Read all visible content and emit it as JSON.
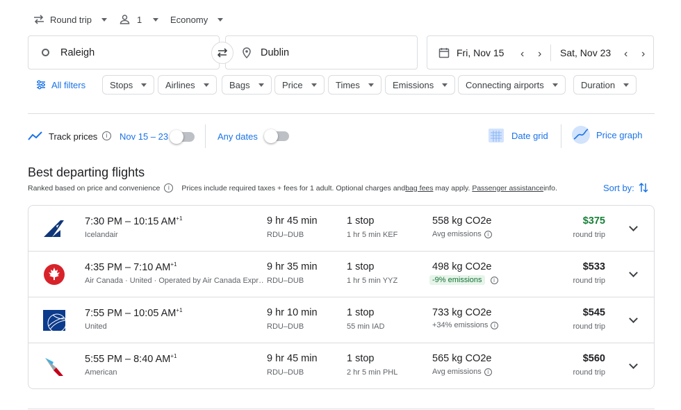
{
  "top": {
    "trip_type": "Round trip",
    "passengers": "1",
    "cabin": "Economy"
  },
  "search": {
    "origin": "Raleigh",
    "destination": "Dublin",
    "depart_date": "Fri, Nov 15",
    "return_date": "Sat, Nov 23"
  },
  "filters": {
    "all_label": "All filters",
    "chips": [
      "Stops",
      "Airlines",
      "Bags",
      "Price",
      "Times",
      "Emissions",
      "Connecting airports",
      "Duration"
    ]
  },
  "tracking": {
    "track_label": "Track prices",
    "date_range": "Nov 15 – 23",
    "any_dates": "Any dates",
    "date_grid": "Date grid",
    "price_graph": "Price graph"
  },
  "section": {
    "title": "Best departing flights",
    "ranked": "Ranked based on price and convenience",
    "info_prefix": "Prices include required taxes + fees for 1 adult. Optional charges and ",
    "bag_fees": "bag fees",
    "info_middle": " may apply. ",
    "passenger_assistance": "Passenger assistance",
    "info_suffix": " info.",
    "sort_label": "Sort by:"
  },
  "flights": [
    {
      "times": "7:30 PM – 10:15 AM",
      "plus_day": "+1",
      "airline": "Icelandair",
      "duration": "9 hr 45 min",
      "route": "RDU–DUB",
      "stops": "1 stop",
      "layover": "1 hr 5 min KEF",
      "co2": "558 kg CO2e",
      "emissions_note": "Avg emissions",
      "price": "$375",
      "price_type": "round trip",
      "price_color": "#188038"
    },
    {
      "times": "4:35 PM – 7:10 AM",
      "plus_day": "+1",
      "airline": "Air Canada · United · Operated by Air Canada Expr…",
      "duration": "9 hr 35 min",
      "route": "RDU–DUB",
      "stops": "1 stop",
      "layover": "1 hr 5 min YYZ",
      "co2": "498 kg CO2e",
      "emissions_note": "-9% emissions",
      "price": "$533",
      "price_type": "round trip",
      "price_color": "#202124"
    },
    {
      "times": "7:55 PM – 10:05 AM",
      "plus_day": "+1",
      "airline": "United",
      "duration": "9 hr 10 min",
      "route": "RDU–DUB",
      "stops": "1 stop",
      "layover": "55 min IAD",
      "co2": "733 kg CO2e",
      "emissions_note": "+34% emissions",
      "price": "$545",
      "price_type": "round trip",
      "price_color": "#202124"
    },
    {
      "times": "5:55 PM – 8:40 AM",
      "plus_day": "+1",
      "airline": "American",
      "duration": "9 hr 45 min",
      "route": "RDU–DUB",
      "stops": "1 stop",
      "layover": "2 hr 5 min PHL",
      "co2": "565 kg CO2e",
      "emissions_note": "Avg emissions",
      "price": "$560",
      "price_type": "round trip",
      "price_color": "#202124"
    }
  ]
}
